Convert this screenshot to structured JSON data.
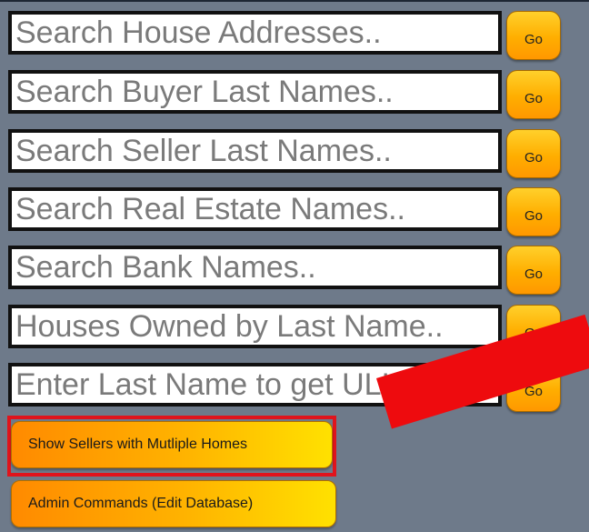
{
  "searches": [
    {
      "placeholder": "Search House Addresses..",
      "button": "Go"
    },
    {
      "placeholder": "Search Buyer Last Names..",
      "button": "Go"
    },
    {
      "placeholder": "Search Seller Last Names..",
      "button": "Go"
    },
    {
      "placeholder": "Search Real Estate Names..",
      "button": "Go"
    },
    {
      "placeholder": "Search Bank Names..",
      "button": "Go"
    },
    {
      "placeholder": "Houses Owned by Last Name..",
      "button": "Go"
    },
    {
      "placeholder": "Enter Last Name to get ULI..",
      "button": "Go"
    }
  ],
  "actions": {
    "multiple_homes": "Show Sellers with Mutliple Homes",
    "admin": "Admin Commands (Edit Database)"
  },
  "colors": {
    "background": "#6e7a8a",
    "button_orange": "#ffae00",
    "highlight_red": "#e0141c"
  }
}
